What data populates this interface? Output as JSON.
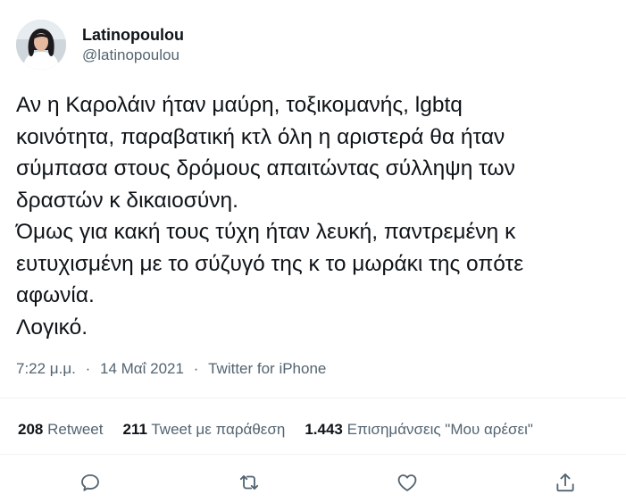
{
  "author": {
    "display_name": "Latinopoulou",
    "handle": "@latinopoulou"
  },
  "tweet": {
    "lines": [
      "Αν η Καρολάιν ήταν μαύρη, τοξικομανής, lgbtq",
      "κοινότητα, παραβατική κτλ όλη η αριστερά θα ήταν",
      "σύμπασα στους δρόμους απαιτώντας σύλληψη των",
      "δραστών κ δικαιοσύνη.",
      "Όμως για κακή τους τύχη ήταν λευκή, παντρεμένη κ",
      "ευτυχισμένη με το σύζυγό της κ το μωράκι της οπότε",
      "αφωνία.",
      "Λογικό."
    ]
  },
  "meta": {
    "time": "7:22 μ.μ.",
    "separator": "·",
    "date": "14 Μαΐ 2021",
    "source": "Twitter for iPhone"
  },
  "stats": {
    "retweets": {
      "count": "208",
      "label": "Retweet"
    },
    "quotes": {
      "count": "211",
      "label": "Tweet με παράθεση"
    },
    "likes": {
      "count": "1.443",
      "label": "Επισημάνσεις \"Μου αρέσει\""
    }
  },
  "actions": [
    "reply-icon",
    "retweet-icon",
    "like-icon",
    "share-icon"
  ],
  "colors": {
    "text": "#0f1419",
    "secondary": "#536471",
    "divider": "#eff3f4",
    "icon": "#536471"
  }
}
